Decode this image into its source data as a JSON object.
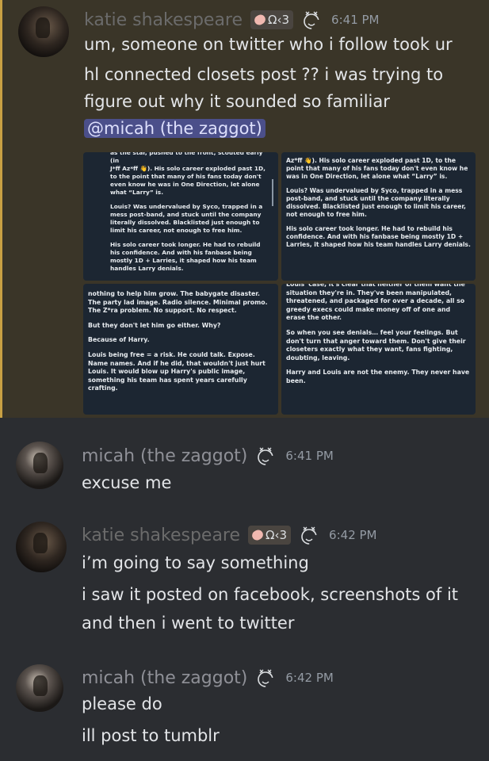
{
  "messages": [
    {
      "username": "katie shakespeare",
      "tag_text": "Ω‹3",
      "time": "6:41 PM",
      "lines": [
        "um, someone on twitter who i follow took ur",
        "hl connected closets post ?? i was trying to",
        "figure out why it sounded so familiar"
      ],
      "mention": "@micah (the zaggot)",
      "screenshots": {
        "s1": [
          "as the star, pushed to the front, scouted early (in",
          "J*ff Az*ff 👋). His solo career exploded past 1D, to the point that many of his fans today don't even know he was in One Direction, let alone what “Larry” is.",
          "Louis? Was undervalued by Syco, trapped in a mess post-band, and stuck until the company literally dissolved. Blacklisted just enough to limit his career, not enough to free him.",
          "His solo career took longer. He had to rebuild his confidence. And with his fanbase being mostly 1D + Larries, it shaped how his team handles Larry denials."
        ],
        "s2": [
          "Az*ff 👋). His solo career exploded past 1D, to the point that many of his fans today don't even know he was in One Direction, let alone what “Larry” is.",
          "Louis? Was undervalued by Syco, trapped in a mess post-band, and stuck until the company literally dissolved. Blacklisted just enough to limit his career, not enough to free him.",
          "His solo career took longer. He had to rebuild his confidence. And with his fanbase being mostly 1D + Larries, it shaped how his team handles Larry denials."
        ],
        "s3": [
          "nothing to help him grow. The babygate disaster. The party lad image. Radio silence. Minimal promo. The Z*ra problem. No support. No respect.",
          "But they don't let him go either. Why?",
          "Because of Harry.",
          "Louis being free = a risk. He could talk. Expose. Name names. And if he did, that wouldn't just hurt Louis. It would blow up Harry's public image, something his team has spent years carefully crafting."
        ],
        "s4": [
          "Louis' case, it's clear that neither of them want the situation they're in. They've been manipulated, threatened, and packaged for over a decade, all so greedy execs could make money off of one and erase the other.",
          "So when you see denials… feel your feelings. But don't turn that anger toward them. Don't give their closeters exactly what they want, fans fighting, doubting, leaving.",
          "Harry and Louis are not the enemy. They never have been."
        ]
      }
    },
    {
      "username": "micah (the zaggot)",
      "time": "6:41 PM",
      "lines": [
        "excuse me"
      ]
    },
    {
      "username": "katie shakespeare",
      "tag_text": "Ω‹3",
      "time": "6:42 PM",
      "lines": [
        "i’m going to say something",
        "i saw it posted on facebook, screenshots of it",
        "and then i went to twitter"
      ]
    },
    {
      "username": "micah (the zaggot)",
      "time": "6:42 PM",
      "lines": [
        "please do",
        "ill post to tumblr"
      ]
    }
  ],
  "colors": {
    "background": "#2b2d31",
    "highlight_bg": "#3a3528",
    "highlight_border": "#c8a043",
    "mention_bg": "#4b4f8a",
    "screenshot_bg": "#1c2632"
  },
  "icons": [
    "avatar",
    "pill-icon",
    "sleepy-face-icon"
  ]
}
